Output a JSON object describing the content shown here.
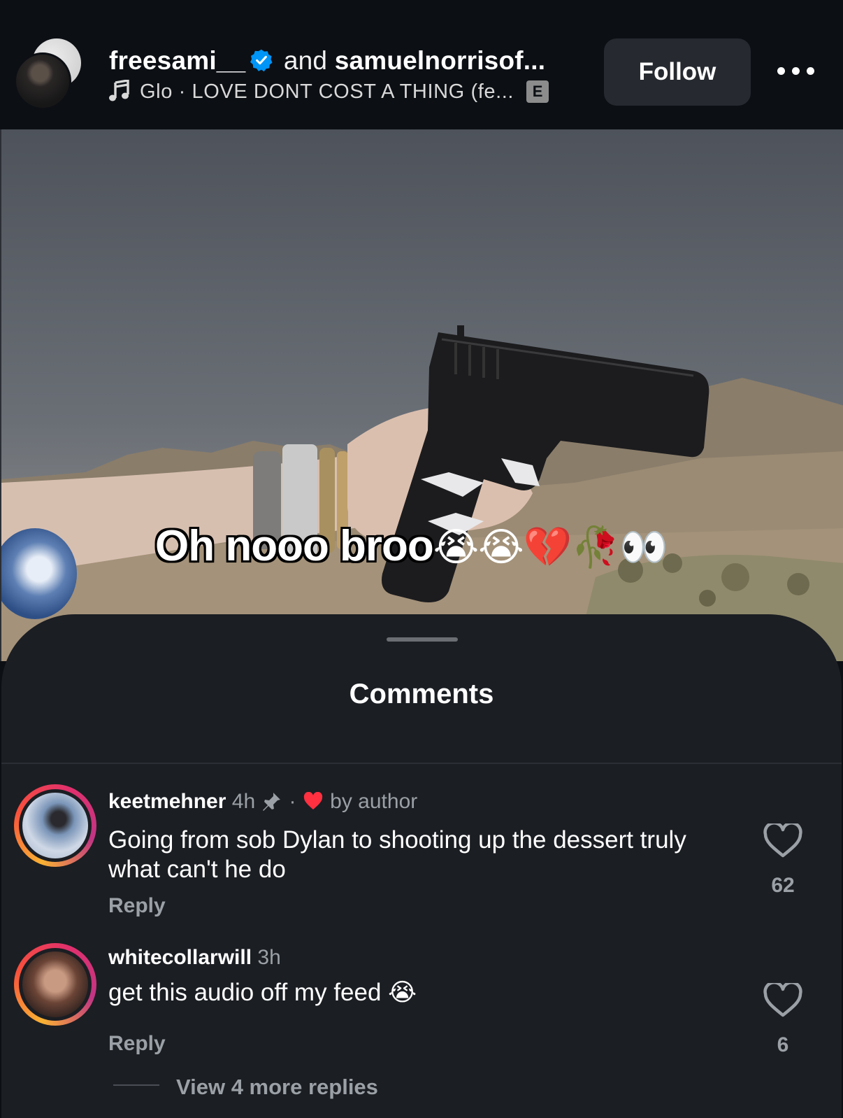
{
  "header": {
    "owner": "freesami__",
    "and_text": "and",
    "collaborator": "samuelnorrisof...",
    "music": "Glo · LOVE DONT COST A THING (fe...",
    "explicit_badge": "E",
    "follow_label": "Follow"
  },
  "video": {
    "caption": "Oh nooo broo",
    "caption_emoji": "😭😭💔🥀👀"
  },
  "comments_sheet": {
    "title": "Comments",
    "comments": [
      {
        "username": "keetmehner",
        "time": "4h",
        "liked_by_author": "by author",
        "text": "Going from sob Dylan to shooting up the dessert truly what can't he do",
        "reply_label": "Reply",
        "likes": "62"
      },
      {
        "username": "whitecollarwill",
        "time": "3h",
        "text": "get this audio off my feed",
        "text_emoji": "😭",
        "reply_label": "Reply",
        "likes": "6"
      }
    ],
    "view_more_replies": "View 4 more replies"
  },
  "colors": {
    "background": "#0c0f14",
    "sheet": "#1b1e23",
    "verified_blue": "#0095f6",
    "heart_red": "#ff3040",
    "muted_text": "#9aa0a6"
  },
  "icons": [
    "verified-badge-icon",
    "music-note-icon",
    "more-options-icon",
    "pin-icon",
    "heart-icon"
  ]
}
